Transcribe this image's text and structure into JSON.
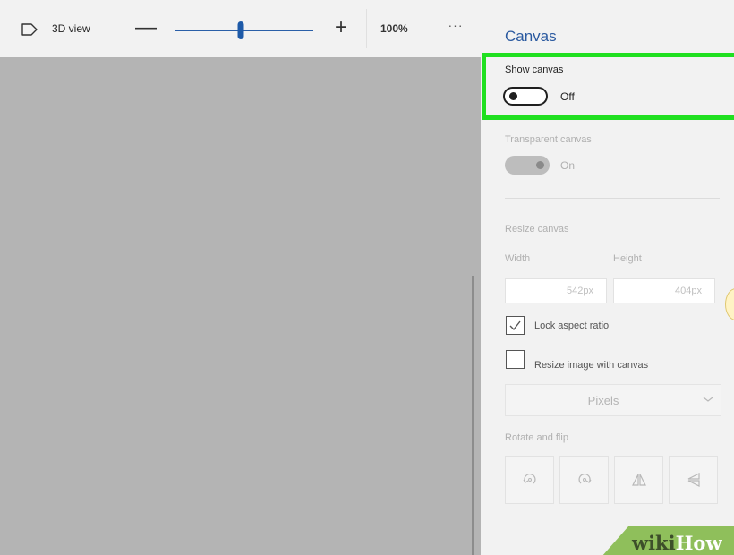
{
  "toolbar": {
    "view_3d_label": "3D view",
    "zoom_value": "100%",
    "zoom_level": 0.48,
    "zoom_out_symbol": "—",
    "zoom_in_symbol": "+",
    "more_symbol": "···",
    "icons": [
      "3d-view-icon",
      "minus-icon",
      "plus-icon",
      "more-icon"
    ]
  },
  "panel": {
    "title": "Canvas",
    "show_canvas": {
      "label": "Show canvas",
      "state_label": "Off",
      "checked": false
    },
    "transparent_canvas": {
      "label": "Transparent canvas",
      "state_label": "On",
      "checked": true,
      "disabled": true
    },
    "resize": {
      "label": "Resize canvas",
      "width_label": "Width",
      "height_label": "Height",
      "width_value": "542px",
      "height_value": "404px",
      "lock_aspect_label": "Lock aspect ratio",
      "lock_aspect_checked": true,
      "resize_image_label": "Resize image with canvas",
      "resize_image_checked": false,
      "unit_value": "Pixels"
    },
    "rotate_flip": {
      "label": "Rotate and flip",
      "buttons": [
        "rotate-left-icon",
        "rotate-right-icon",
        "flip-horizontal-icon",
        "flip-vertical-icon"
      ]
    }
  },
  "highlight_color": "#20e020",
  "accent_color": "#2b5aa0",
  "watermark": {
    "part1": "wiki",
    "part2": "How"
  }
}
